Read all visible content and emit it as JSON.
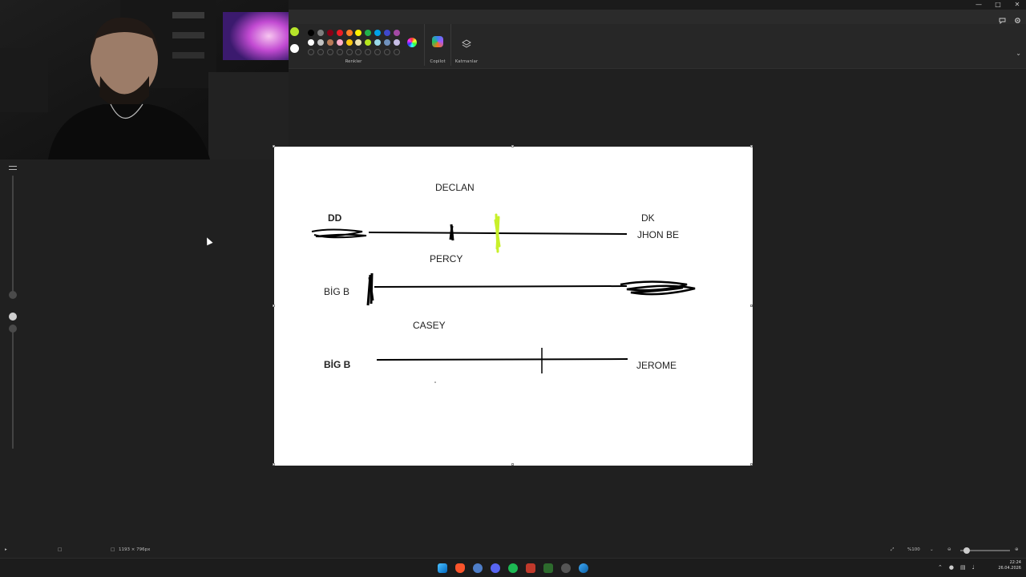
{
  "ribbon": {
    "colors_label": "Renkler",
    "copilot_label": "Copilot",
    "layers_label": "Katmanlar",
    "active_colors": [
      "#b7e52a",
      "#ffffff"
    ],
    "palette_row1": [
      "#000000",
      "#7f7f7f",
      "#880015",
      "#ed1c24",
      "#ff7f27",
      "#fff200",
      "#22b14c",
      "#00a2e8",
      "#3f48cc",
      "#a349a4"
    ],
    "palette_row2": [
      "#ffffff",
      "#c3c3c3",
      "#b97a57",
      "#ffaec9",
      "#ffc90e",
      "#efe4b0",
      "#b5e61d",
      "#99d9ea",
      "#7092be",
      "#c8bfe7"
    ]
  },
  "canvas": {
    "labels": {
      "declan": "DECLAN",
      "dd": "DD",
      "dk": "DK",
      "jhon_be": "JHON BE",
      "percy": "PERCY",
      "big_b_1": "BİG B",
      "casey": "CASEY",
      "big_b_2": "BİG B",
      "jerome": "JEROME"
    },
    "marker_color": "#c8f02a"
  },
  "status": {
    "canvas_size": "1193 × 796px",
    "zoom": "%100"
  },
  "taskbar": {
    "time": "22:24",
    "date": "26.04.2026"
  }
}
